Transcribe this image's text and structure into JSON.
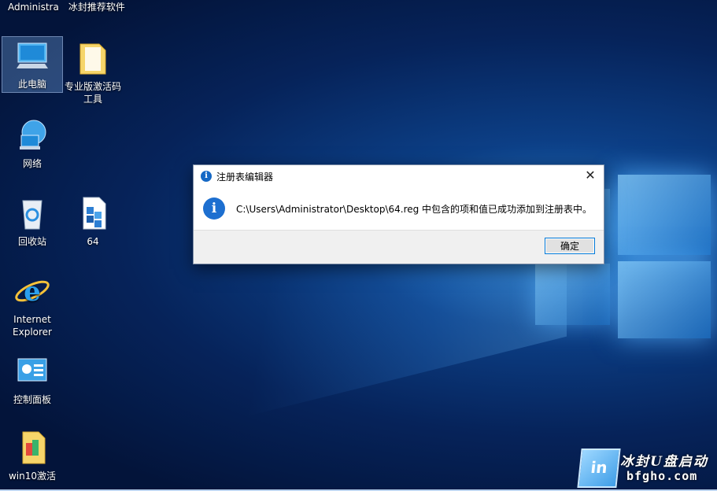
{
  "topbar": {
    "items": [
      "Administra",
      "冰封推荐软件"
    ]
  },
  "desktop_icons": {
    "this_pc": "此电脑",
    "activation_tool": "专业版激活码工具",
    "network": "网络",
    "recycle_bin": "回收站",
    "reg_file": "64",
    "ie_line1": "Internet",
    "ie_line2": "Explorer",
    "control_panel": "控制面板",
    "win10_activate": "win10激活"
  },
  "dialog": {
    "title": "注册表编辑器",
    "message": "C:\\Users\\Administrator\\Desktop\\64.reg 中包含的项和值已成功添加到注册表中。",
    "ok_label": "确定",
    "close_glyph": "✕",
    "info_glyph": "i"
  },
  "watermark": {
    "logo_text": "in",
    "name": "冰封U盘启动",
    "url": "bfgho.com"
  },
  "colors": {
    "accent": "#0078d7",
    "info_blue": "#1d6fd0"
  }
}
